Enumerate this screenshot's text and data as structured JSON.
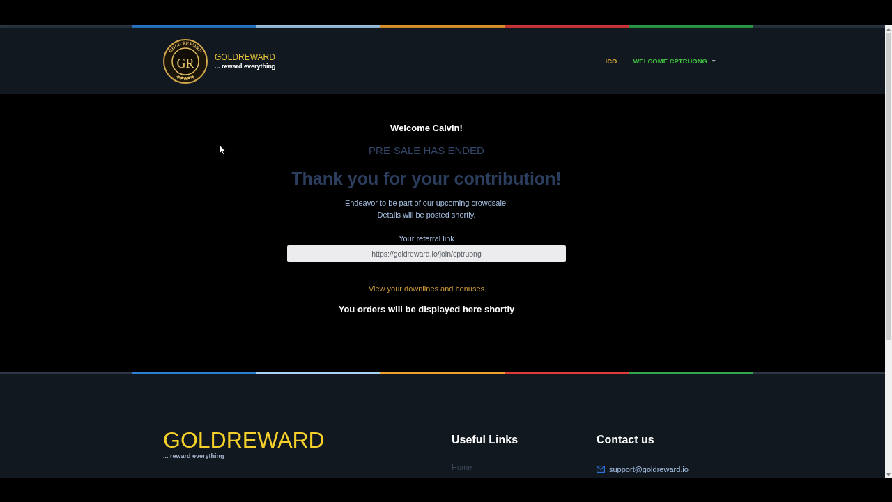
{
  "header": {
    "logo": {
      "emblem_text": "GOLD REWARD",
      "monogram": "GR",
      "name": "GOLDREWARD",
      "tagline": "... reward everything"
    },
    "nav": [
      {
        "label": "ICO",
        "kind": "link"
      },
      {
        "label": "WELCOME CPTRUONG",
        "kind": "dropdown"
      }
    ]
  },
  "main": {
    "greeting": "Welcome Calvin!",
    "status": "PRE-SALE HAS ENDED",
    "headline": "Thank you for your contribution!",
    "message": [
      "Endeavor to be part of our upcoming crowdsale.",
      "Details will be posted shortly."
    ],
    "referral": {
      "label": "Your referral link",
      "value": "https://goldreward.io/join/cptruong"
    },
    "downlines_link": "View your downlines and bonuses",
    "orders_note": "You orders will be displayed here shortly"
  },
  "footer": {
    "brand": {
      "name": "GOLDREWARD",
      "tagline": "... reward everything"
    },
    "useful_links": {
      "title": "Useful Links",
      "links": [
        "Home"
      ]
    },
    "contact": {
      "title": "Contact us",
      "items": [
        {
          "kind": "email",
          "text": "support@goldreward.io"
        }
      ]
    }
  }
}
